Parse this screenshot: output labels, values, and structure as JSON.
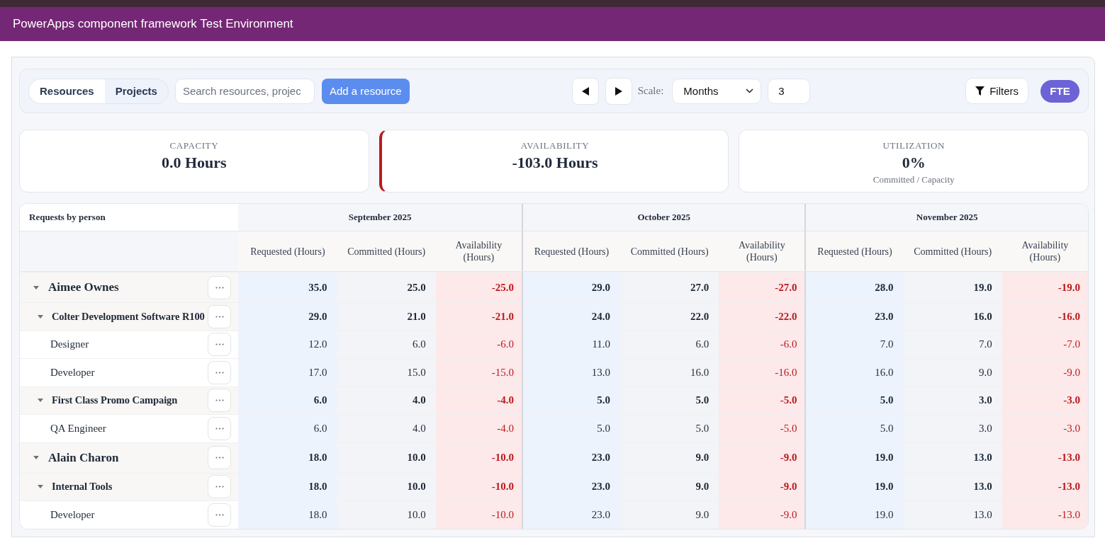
{
  "app_bar": {
    "title": "PowerApps component framework Test Environment"
  },
  "toolbar": {
    "view_tabs": [
      {
        "label": "Resources",
        "selected": true
      },
      {
        "label": "Projects",
        "selected": false
      }
    ],
    "search": {
      "placeholder": "Search resources, projec"
    },
    "add_button": {
      "label": "Add a resource"
    },
    "scale_label": "Scale:",
    "scale_select": {
      "value": "Months"
    },
    "range_field": {
      "value": "3"
    },
    "filters_button": {
      "label": "Filters"
    },
    "unit_button": {
      "label": "FTE"
    }
  },
  "stats": [
    {
      "label": "CAPACITY",
      "value": "0.0 Hours",
      "alert": false
    },
    {
      "label": "AVAILABILITY",
      "value": "-103.0 Hours",
      "alert": true
    },
    {
      "label": "UTILIZATION",
      "value": "0%",
      "note": "Committed / Capacity",
      "alert": false
    }
  ],
  "table": {
    "title": "Requests by person",
    "months": [
      {
        "label": "September 2025",
        "columns": [
          "Requested (Hours)",
          "Committed (Hours)",
          "Availability (Hours)"
        ]
      },
      {
        "label": "October 2025",
        "columns": [
          "Requested (Hours)",
          "Committed (Hours)",
          "Availability (Hours)"
        ]
      },
      {
        "label": "November 2025",
        "columns": [
          "Requested (Hours)",
          "Committed (Hours)",
          "Availability (Hours)"
        ]
      }
    ],
    "rows": [
      {
        "name": "Aimee Ownes",
        "expanded": true,
        "values": [
          "35.0",
          "25.0",
          "-25.0",
          "29.0",
          "27.0",
          "-27.0",
          "28.0",
          "19.0",
          "-19.0"
        ],
        "children": [
          {
            "name": "Colter Development Software R100",
            "expanded": true,
            "values": [
              "29.0",
              "21.0",
              "-21.0",
              "24.0",
              "22.0",
              "-22.0",
              "23.0",
              "16.0",
              "-16.0"
            ],
            "children": [
              {
                "name": "Designer",
                "values": [
                  "12.0",
                  "6.0",
                  "-6.0",
                  "11.0",
                  "6.0",
                  "-6.0",
                  "7.0",
                  "7.0",
                  "-7.0"
                ]
              },
              {
                "name": "Developer",
                "values": [
                  "17.0",
                  "15.0",
                  "-15.0",
                  "13.0",
                  "16.0",
                  "-16.0",
                  "16.0",
                  "9.0",
                  "-9.0"
                ]
              }
            ]
          },
          {
            "name": "First Class Promo Campaign",
            "expanded": true,
            "values": [
              "6.0",
              "4.0",
              "-4.0",
              "5.0",
              "5.0",
              "-5.0",
              "5.0",
              "3.0",
              "-3.0"
            ],
            "children": [
              {
                "name": "QA Engineer",
                "values": [
                  "6.0",
                  "4.0",
                  "-4.0",
                  "5.0",
                  "5.0",
                  "-5.0",
                  "5.0",
                  "3.0",
                  "-3.0"
                ]
              }
            ]
          }
        ]
      },
      {
        "name": "Alain Charon",
        "expanded": true,
        "values": [
          "18.0",
          "10.0",
          "-10.0",
          "23.0",
          "9.0",
          "-9.0",
          "19.0",
          "13.0",
          "-13.0"
        ],
        "children": [
          {
            "name": "Internal Tools",
            "expanded": true,
            "values": [
              "18.0",
              "10.0",
              "-10.0",
              "23.0",
              "9.0",
              "-9.0",
              "19.0",
              "13.0",
              "-13.0"
            ],
            "children": [
              {
                "name": "Developer",
                "values": [
                  "18.0",
                  "10.0",
                  "-10.0",
                  "23.0",
                  "9.0",
                  "-9.0",
                  "19.0",
                  "13.0",
                  "-13.0"
                ]
              }
            ]
          }
        ]
      }
    ]
  }
}
